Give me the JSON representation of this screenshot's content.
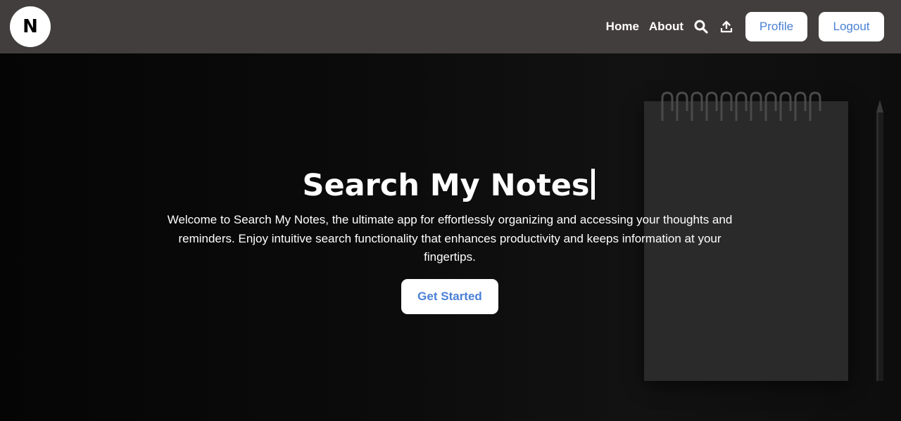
{
  "navbar": {
    "logo_letter": "N",
    "links": {
      "home": "Home",
      "about": "About"
    },
    "icons": [
      "search-icon",
      "upload-icon"
    ],
    "profile_label": "Profile",
    "logout_label": "Logout"
  },
  "hero": {
    "title": "Search My Notes",
    "description": "Welcome to Search My Notes, the ultimate app for effortlessly organizing and accessing your thoughts and reminders. Enjoy intuitive search functionality that enhances productivity and keeps information at your fingertips.",
    "cta_label": "Get Started"
  },
  "colors": {
    "navbar_bg": "#433e3e",
    "accent_text": "#4a80d6",
    "hero_bg": "#0b0b0b",
    "button_bg": "#ffffff"
  }
}
